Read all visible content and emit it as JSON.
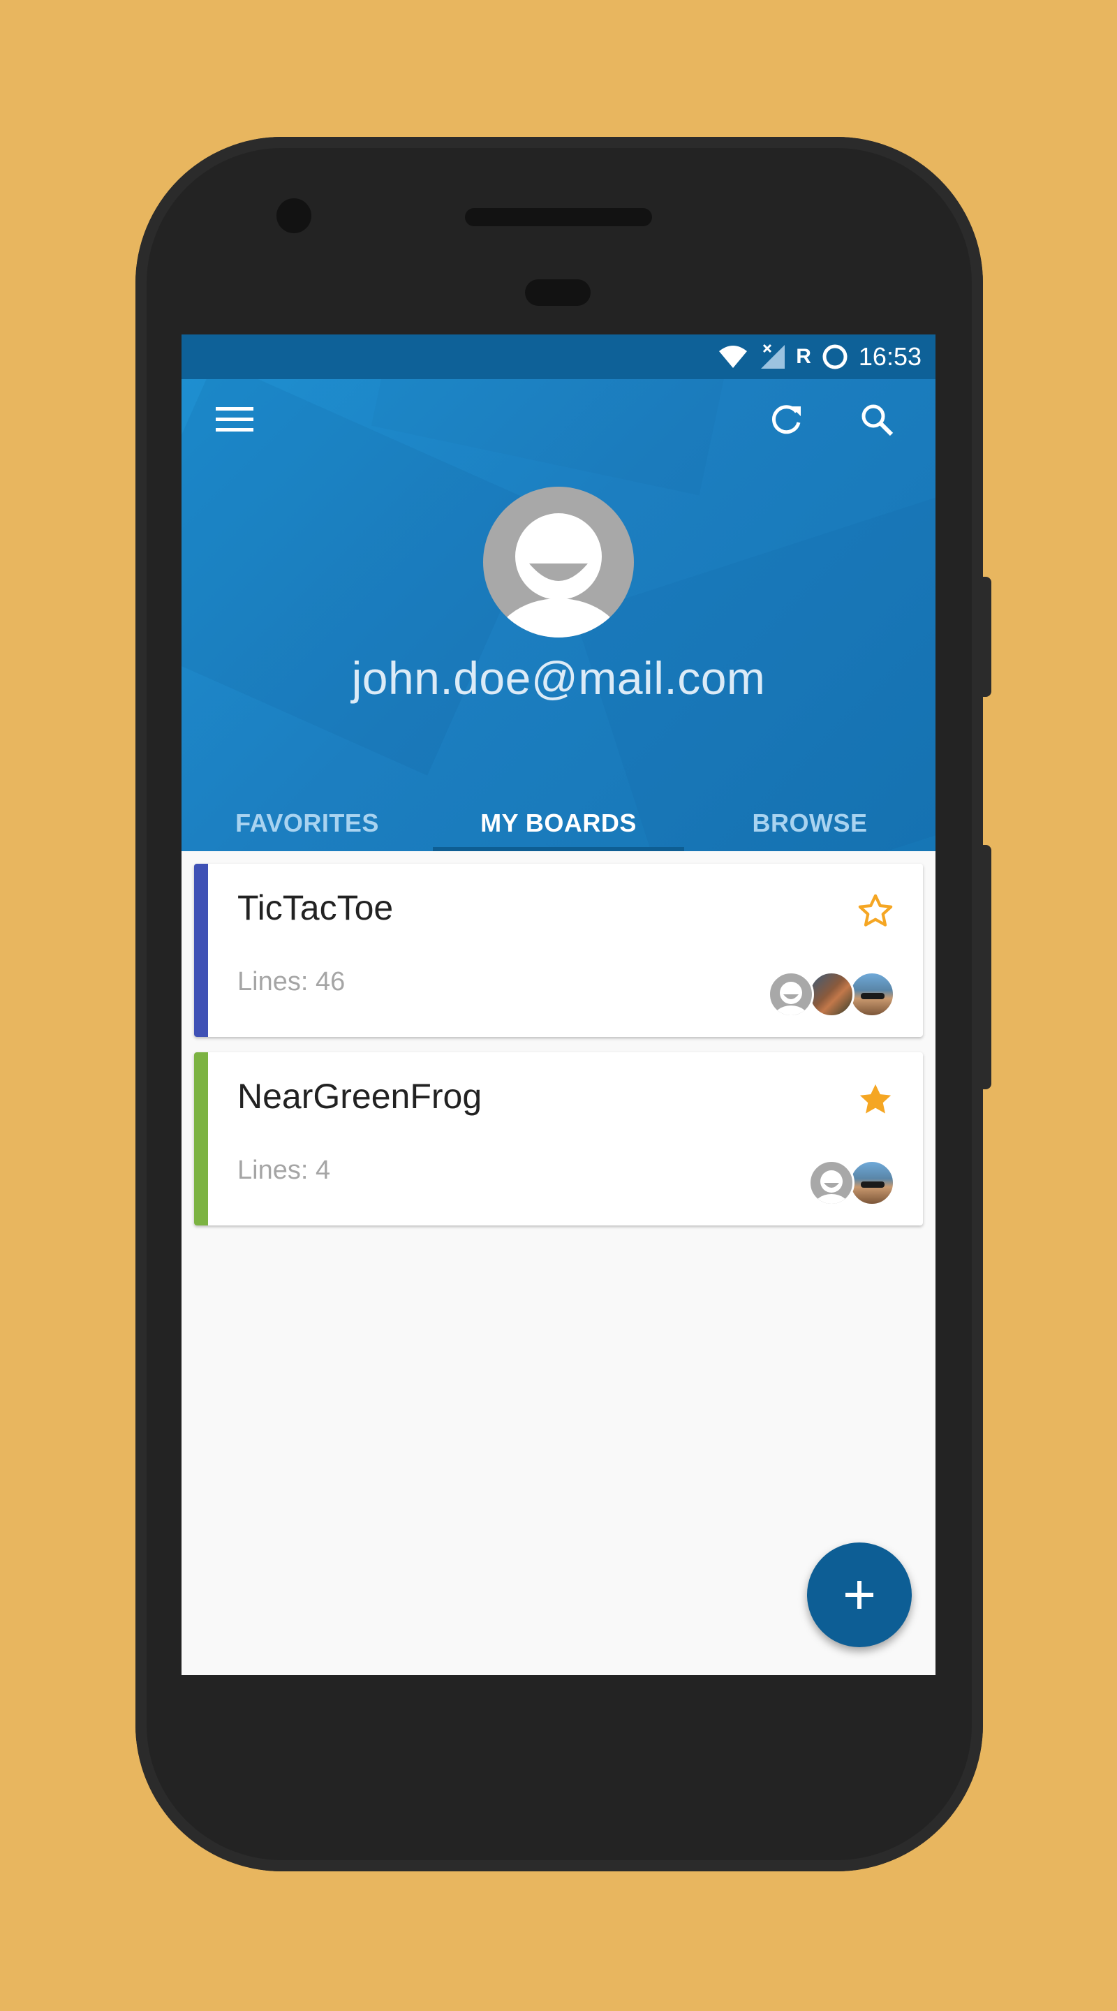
{
  "status_bar": {
    "time": "16:53",
    "roaming_label": "R",
    "icons": [
      "wifi-icon",
      "signal-x-icon",
      "roaming-icon",
      "sync-ring-icon"
    ]
  },
  "toolbar": {
    "icons": [
      "menu-icon",
      "refresh-icon",
      "search-icon"
    ]
  },
  "profile": {
    "avatar_icon": "default-avatar-icon",
    "email": "john.doe@mail.com"
  },
  "tabs": [
    {
      "label": "FAVORITES",
      "active": false
    },
    {
      "label": "MY BOARDS",
      "active": true
    },
    {
      "label": "BROWSE",
      "active": false
    }
  ],
  "boards": [
    {
      "name": "TicTacToe",
      "lines": "Lines: 46",
      "stripe_color": "#3F51B5",
      "favorite": false,
      "members": [
        "default-avatar",
        "photo-avatar-1",
        "photo-avatar-2"
      ]
    },
    {
      "name": "NearGreenFrog",
      "lines": "Lines: 4",
      "stripe_color": "#7CB342",
      "favorite": true,
      "members": [
        "default-avatar",
        "photo-avatar-2"
      ]
    }
  ],
  "fab": {
    "icon": "plus-icon"
  },
  "colors": {
    "background": "#E8B65F",
    "primary": "#1C7EC0",
    "primary_dark": "#0E6198",
    "accent_star": "#F5A623",
    "fab": "#0D5E95"
  }
}
